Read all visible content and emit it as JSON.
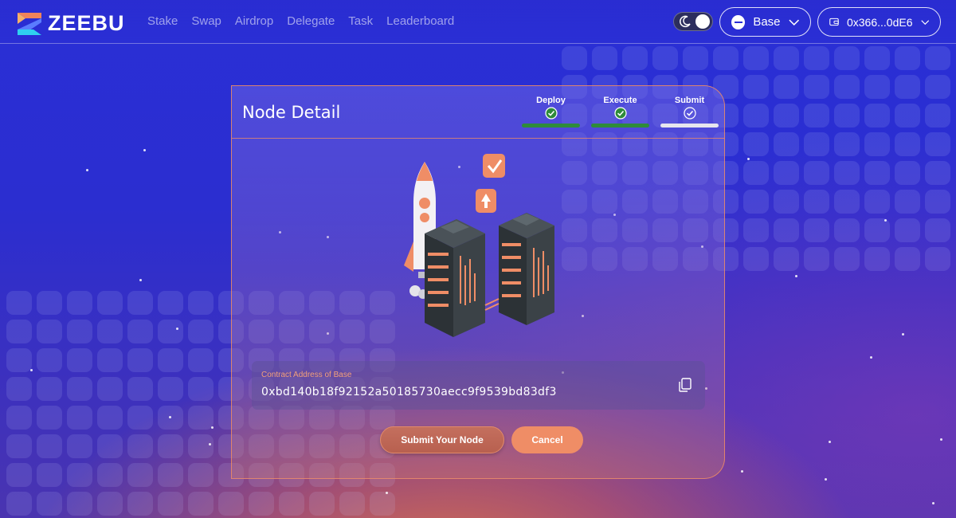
{
  "header": {
    "logo_text": "ZEEBU",
    "nav": [
      "Stake",
      "Swap",
      "Airdrop",
      "Delegate",
      "Task",
      "Leaderboard"
    ],
    "theme_toggle": "dark",
    "network": {
      "label": "Base",
      "icon": "base-network-icon"
    },
    "wallet": {
      "label": "0x366...0dE6",
      "icon": "wallet-icon"
    }
  },
  "card": {
    "title": "Node Detail",
    "steps": [
      {
        "label": "Deploy",
        "status": "done",
        "color": "#2e8b3a"
      },
      {
        "label": "Execute",
        "status": "done",
        "color": "#2e8b3a"
      },
      {
        "label": "Submit",
        "status": "current",
        "color": "#e6e6ee"
      }
    ],
    "illustration": "rocket-and-servers-illustration",
    "contract": {
      "label": "Contract Address of Base",
      "value": "0xbd140b18f92152a50185730aecc9f9539bd83df3",
      "copy_icon": "copy-icon"
    },
    "buttons": {
      "submit": "Submit Your Node",
      "cancel": "Cancel"
    }
  },
  "colors": {
    "accent": "#ef8d66",
    "success": "#2e8b3a",
    "background": "#2a2fd6"
  }
}
